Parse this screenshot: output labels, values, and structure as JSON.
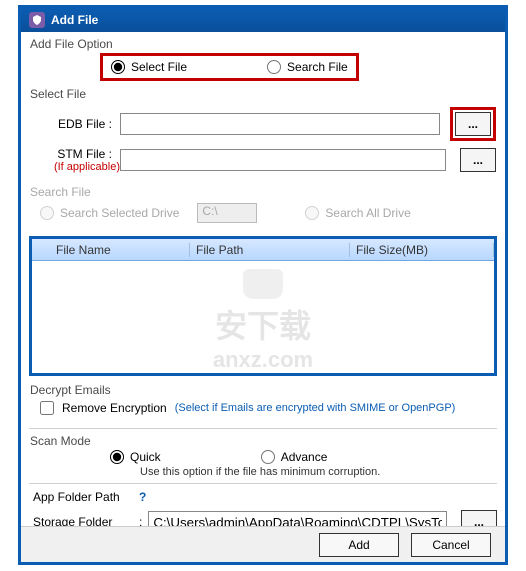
{
  "titlebar": {
    "title": "Add File"
  },
  "addFileOption": {
    "title": "Add File Option",
    "selectFile": "Select File",
    "searchFile": "Search File"
  },
  "selectFile": {
    "title": "Select File",
    "edbLabel": "EDB File :",
    "edbValue": "",
    "stmLabel": "STM File :",
    "stmValue": "",
    "stmNote": "(If applicable)",
    "browse": "..."
  },
  "searchFile": {
    "title": "Search File",
    "searchSelected": "Search Selected Drive",
    "driveValue": "C:\\",
    "searchAll": "Search All Drive"
  },
  "table": {
    "col1": "File Name",
    "col2": "File Path",
    "col3": "File Size(MB)"
  },
  "watermark": {
    "text1": "安下载",
    "text2": "anxz.com"
  },
  "decrypt": {
    "title": "Decrypt Emails",
    "remove": "Remove Encryption",
    "hint": "(Select if Emails are encrypted with SMIME or OpenPGP)"
  },
  "scanMode": {
    "title": "Scan Mode",
    "quick": "Quick",
    "advance": "Advance",
    "note": "Use this option if the file has minimum corruption."
  },
  "appFolder": {
    "label": "App Folder Path",
    "q": "?"
  },
  "storage": {
    "label": "Storage Folder",
    "colon": ":",
    "value": "C:\\Users\\admin\\AppData\\Roaming\\CDTPL\\SysTools E",
    "browse": "..."
  },
  "buttons": {
    "add": "Add",
    "cancel": "Cancel"
  }
}
